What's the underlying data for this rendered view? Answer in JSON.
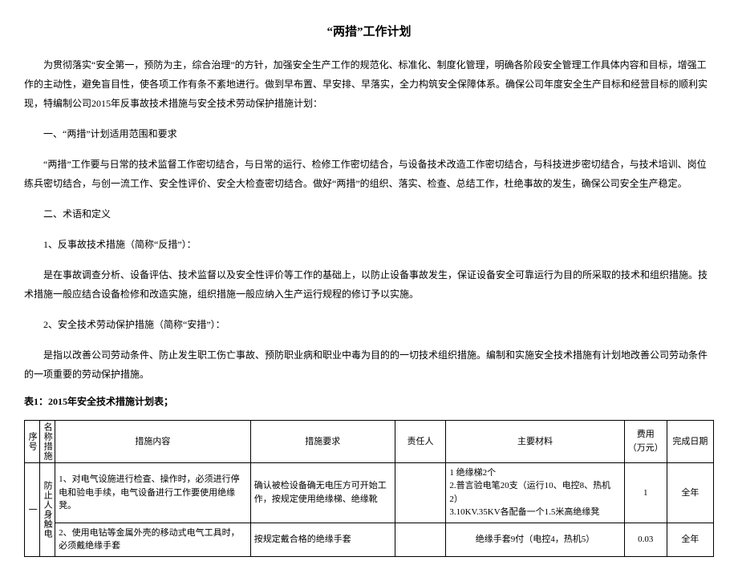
{
  "title": "“两措”工作计划",
  "paragraphs": {
    "p1": "为贯彻落实“安全第一，预防为主，综合治理”的方针，加强安全生产工作的规范化、标准化、制度化管理，明确各阶段安全管理工作具体内容和目标，增强工作的主动性，避免盲目性，使各项工作有条不紊地进行。做到早布置、早安排、早落实，全力构筑安全保障体系。确保公司年度安全生产目标和经营目标的顺利实现，特编制公司2015年反事故技术措施与安全技术劳动保护措施计划：",
    "h1": "一、“两措”计划适用范围和要求",
    "p2": "“两措”工作要与日常的技术监督工作密切结合，与日常的运行、检修工作密切结合，与设备技术改造工作密切结合，与科技进步密切结合，与技术培训、岗位练兵密切结合，与创一流工作、安全性评价、安全大检查密切结合。做好“两措”的组织、落实、检查、总结工作，杜绝事故的发生，确保公司安全生产稳定。",
    "h2": "二、术语和定义",
    "h2a": "1、反事故技术措施（简称“反措”）：",
    "p3": "是在事故调查分析、设备评估、技术监督以及安全性评价等工作的基础上，以防止设备事故发生，保证设备安全可靠运行为目的所采取的技术和组织措施。技术措施一般应结合设备检修和改造实施，组织措施一般应纳入生产运行规程的修订予以实施。",
    "h2b": "2、安全技术劳动保护措施（简称“安措”）：",
    "p4": "是指以改善公司劳动条件、防止发生职工伤亡事故、预防职业病和职业中毒为目的的一切技术组织措施。编制和实施安全技术措施有计划地改善公司劳动条件的一项重要的劳动保护措施。"
  },
  "table_caption": "表1：2015年安全技术措施计划表；",
  "headers": {
    "seq": "序号",
    "name": "名称措施",
    "content": "措施内容",
    "req": "措施要求",
    "owner": "责任人",
    "mat": "主要材料",
    "cost": "费用（万元）",
    "date": "完成日期"
  },
  "rows": [
    {
      "seq": "一",
      "name": "防止人身触电",
      "content": "1、对电气设施进行检查、操作时，必须进行停电和验电手续，电气设备进行工作要使用绝缘凳。",
      "req": "确认被检设备确无电压方可开始工作，按规定使用绝缘梯、绝缘靴",
      "owner": "",
      "mat": "1 绝缘梯2个\n2.普言验电笔20支（运行10、电控8、热机2）\n3.10KV.35KV各配备一个1.5米高绝缘凳",
      "cost": "1",
      "date": "全年"
    },
    {
      "content": "2、使用电钻等金属外壳的移动式电气工具时，必须戴绝缘手套",
      "req": "按规定戴合格的绝缘手套",
      "owner": "",
      "mat": "绝缘手套9付（电控4，热机5）",
      "cost": "0.03",
      "date": "全年"
    }
  ]
}
